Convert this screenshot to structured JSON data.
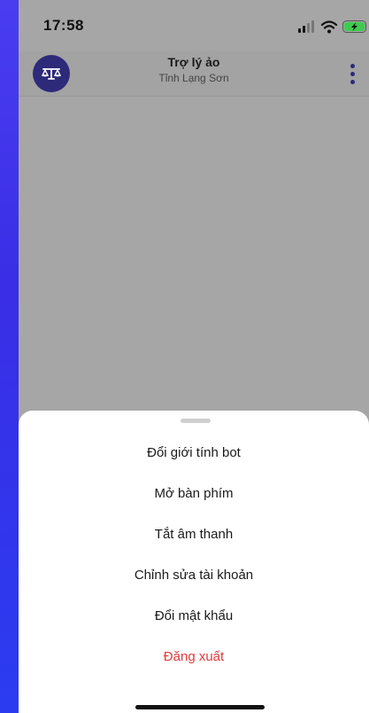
{
  "status_bar": {
    "time": "17:58",
    "icons": [
      "signal-icon",
      "wifi-icon",
      "battery-charging-icon"
    ]
  },
  "header": {
    "avatar_icon": "scales-of-justice-icon",
    "title": "Trợ lý ảo",
    "subtitle": "Tỉnh Lạng Sơn",
    "more_icon": "more-vertical-icon"
  },
  "menu": {
    "items": [
      {
        "label": "Đổi giới tính bot"
      },
      {
        "label": "Mở bàn phím"
      },
      {
        "label": "Tắt âm thanh"
      },
      {
        "label": "Chỉnh sửa tài khoản"
      },
      {
        "label": "Đổi mật khẩu"
      },
      {
        "label": "Đăng xuất"
      }
    ]
  },
  "colors": {
    "brand": "#2e2a7a",
    "background": "#3a2ee6",
    "danger": "#e23b3b",
    "overlay": "#a6a6a6"
  }
}
